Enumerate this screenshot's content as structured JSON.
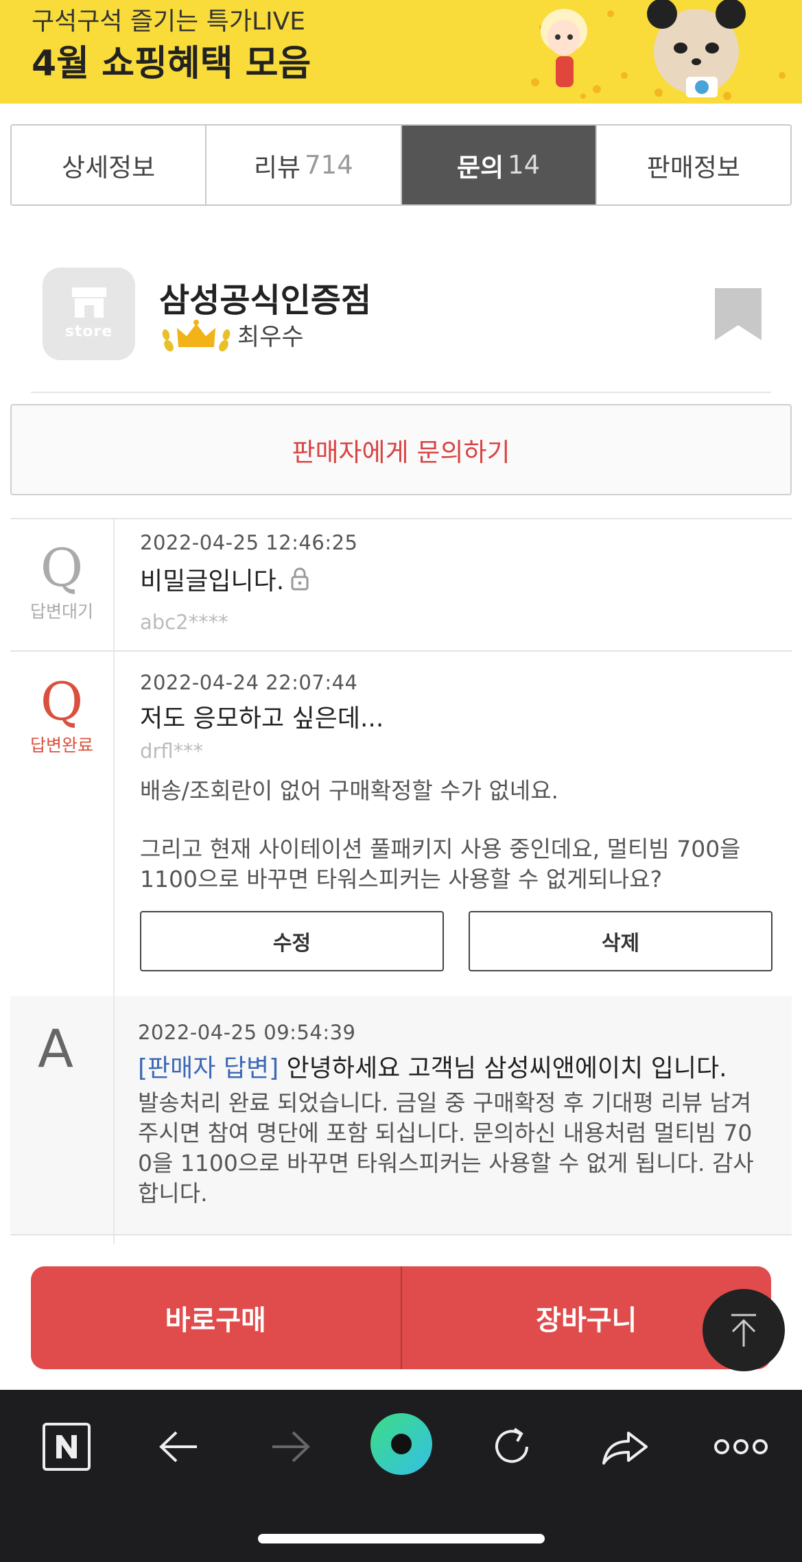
{
  "banner": {
    "line1": "구석구석 즐기는 특가LIVE",
    "line2": "4월 쇼핑혜택 모음"
  },
  "tabs": [
    {
      "label": "상세정보",
      "count": ""
    },
    {
      "label": "리뷰",
      "count": "714"
    },
    {
      "label": "문의",
      "count": "14"
    },
    {
      "label": "판매정보",
      "count": ""
    }
  ],
  "active_tab": "문의",
  "store": {
    "logo_text": "store",
    "name": "삼성공식인증점",
    "grade": "최우수"
  },
  "inquiry_button": "판매자에게 문의하기",
  "questions": [
    {
      "letter": "Q",
      "status": "답변대기",
      "date": "2022-04-25 12:46:25",
      "title": "비밀글입니다.",
      "author": "abc2****"
    },
    {
      "letter": "Q",
      "status": "답변완료",
      "date": "2022-04-24 22:07:44",
      "title": "저도 응모하고 싶은데...",
      "author": "drfl***",
      "body_line1": "배송/조회란이 없어 구매확정할 수가 없네요.",
      "body_line2": "그리고 현재 사이테이션 풀패키지 사용 중인데요, 멀티빔 700을",
      "body_line3": "1100으로 바꾸면 타워스피커는 사용할 수 없게되나요?",
      "edit_label": "수정",
      "delete_label": "삭제"
    }
  ],
  "answer": {
    "letter": "A",
    "date": "2022-04-25 09:54:39",
    "seller_tag": "[판매자 답변]",
    "title": "안녕하세요 고객님 삼성씨앤에이치 입니다.",
    "body_line1": "발송처리 완료 되었습니다. 금일 중 구매확정 후 기대평 리뷰 남겨",
    "body_line2": "주시면 참여 명단에 포함 되십니다. 문의하신 내용처럼 멀티빔 70",
    "body_line3": "0을 1100으로 바꾸면 타워스피커는 사용할 수 없게 됩니다. 감사",
    "body_line4": "합니다."
  },
  "purchase_bar": {
    "buy_now": "바로구매",
    "cart": "장바구니"
  },
  "toolbar_icons": [
    "naver-n-icon",
    "back-arrow-icon",
    "forward-arrow-icon",
    "green-dot-icon",
    "refresh-icon",
    "share-icon",
    "more-icon"
  ],
  "colors": {
    "banner_bg": "#f9dc3a",
    "accent_red": "#e04b4b",
    "seller_blue": "#3b68b5",
    "toolbar_bg": "#1d1d1f",
    "green_gradient_start": "#3ddc84",
    "green_gradient_end": "#34c0e6"
  }
}
